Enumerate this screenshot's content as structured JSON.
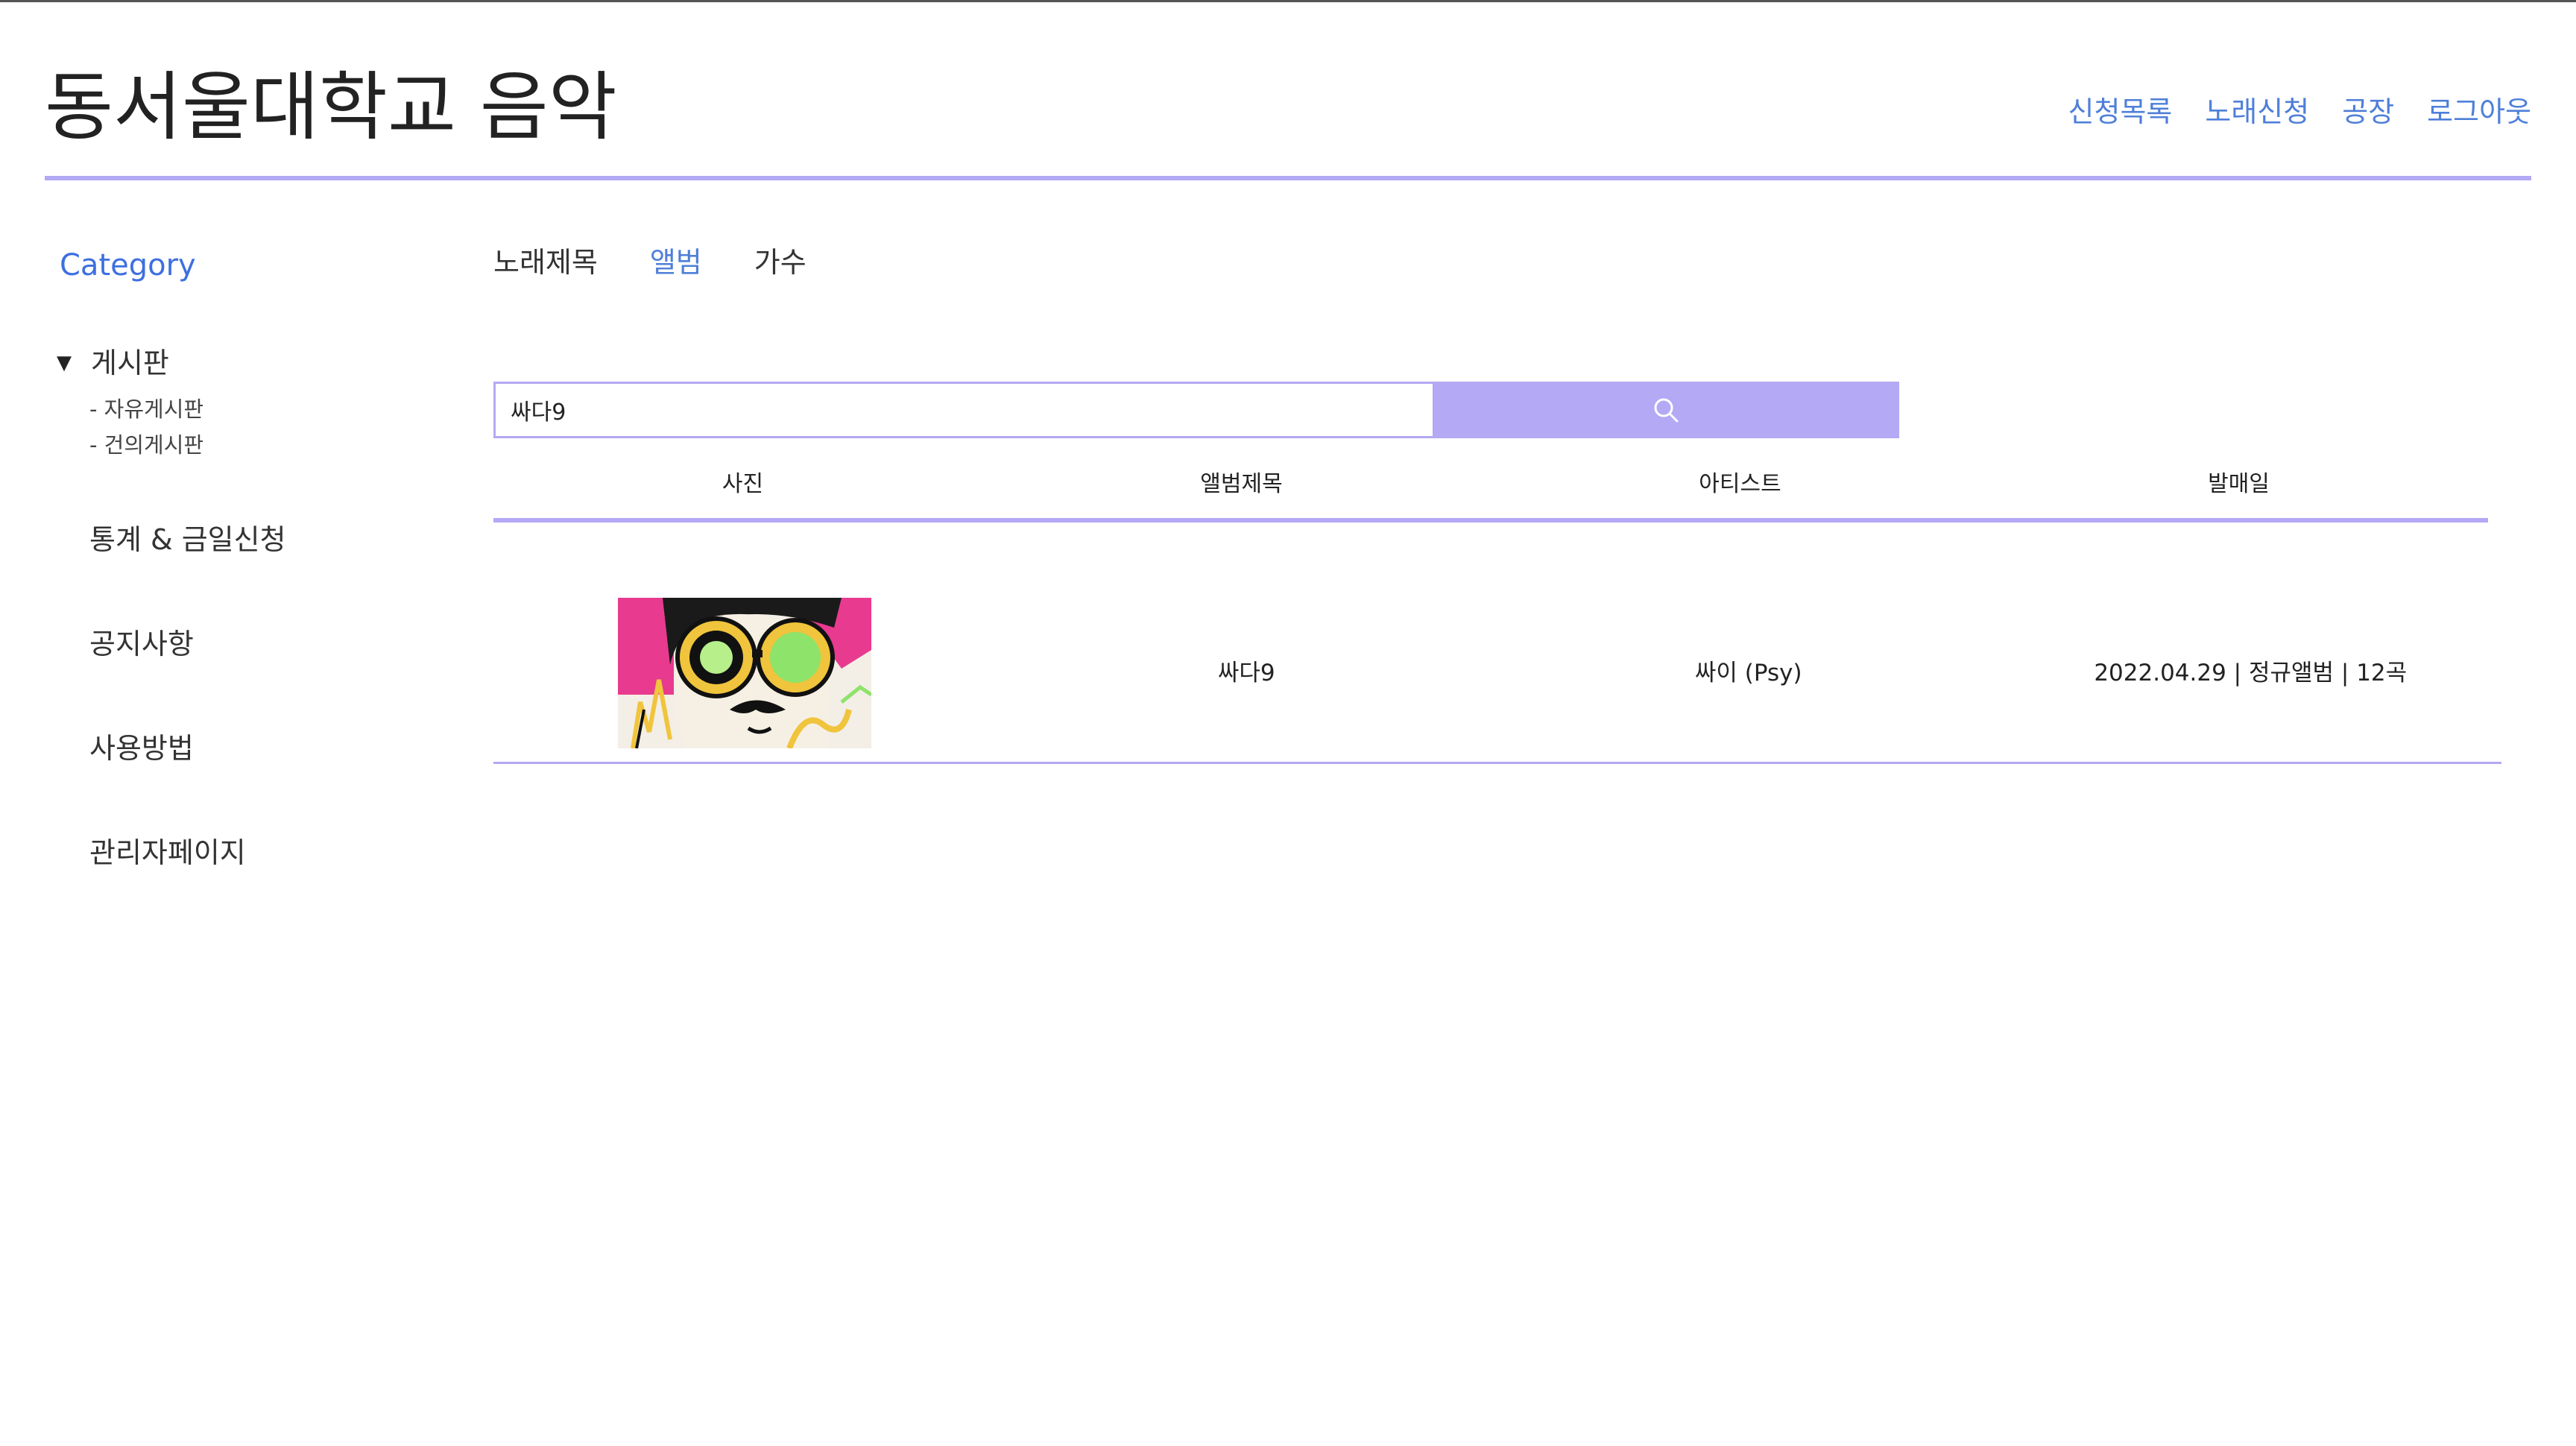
{
  "header": {
    "site_title": "동서울대학교 음악",
    "nav": [
      "신청목록",
      "노래신청",
      "공장",
      "로그아웃"
    ]
  },
  "sidebar": {
    "category_label": "Category",
    "board": {
      "label": "게시판",
      "toggle_glyph": "▼",
      "sub_items": [
        "- 자유게시판",
        "- 건의게시판"
      ]
    },
    "items": [
      "통계 & 금일신청",
      "공지사항",
      "사용방법",
      "관리자페이지"
    ]
  },
  "tabs": {
    "items": [
      "노래제목",
      "앨범",
      "가수"
    ],
    "active": "앨범"
  },
  "search": {
    "value": "싸다9",
    "button_icon": "search-icon"
  },
  "table": {
    "headers": [
      "사진",
      "앨범제목",
      "아티스트",
      "발매일"
    ],
    "rows": [
      {
        "photo": "album-cover-image",
        "album_title": "싸다9",
        "artist": "싸이 (Psy)",
        "release": "2022.04.29 | 정규앨범 | 12곡"
      }
    ]
  },
  "colors": {
    "accent": "#b3a9f5",
    "link": "#4e7fd9",
    "text": "#333333"
  }
}
